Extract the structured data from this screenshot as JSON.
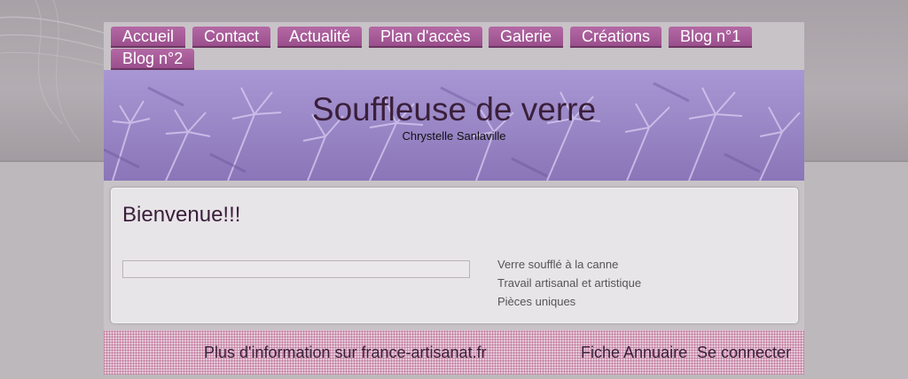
{
  "nav": {
    "tabs": [
      {
        "label": "Accueil"
      },
      {
        "label": "Contact"
      },
      {
        "label": "Actualité"
      },
      {
        "label": "Plan d'accès"
      },
      {
        "label": "Galerie"
      },
      {
        "label": "Créations"
      },
      {
        "label": "Blog n°1"
      },
      {
        "label": "Blog n°2"
      }
    ]
  },
  "header": {
    "title": "Souffleuse de verre",
    "subtitle": "Chrystelle Sanlaville"
  },
  "main": {
    "heading": "Bienvenue!!!",
    "features": [
      "Verre soufflé à la canne",
      "Travail artisanal et artistique",
      "Pièces uniques"
    ]
  },
  "footer": {
    "info": "Plus d'information sur france-artisanat.fr",
    "directory": "Fiche Annuaire",
    "login": "Se connecter"
  },
  "colors": {
    "tab": "#9a4f8c",
    "banner": "#9d8cc8",
    "title": "#3a1f3a",
    "footer": "#e6c8d8"
  }
}
